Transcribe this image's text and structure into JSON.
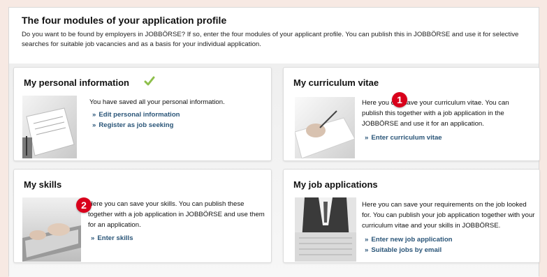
{
  "header": {
    "title": "The four modules of your application profile",
    "intro": "Do you want to be found by employers in JOBBÖRSE? If so, enter the four modules of your applicant profile. You can publish this in JOBBÖRSE and use it for selective searches for suitable job vacancies and as a basis for your individual application."
  },
  "modules": {
    "personal": {
      "title": "My personal information",
      "text": "You have saved all your personal information.",
      "links": [
        "Edit personal information",
        "Register as job seeking"
      ],
      "status_icon": "checkmark-icon"
    },
    "cv": {
      "title": "My curriculum vitae",
      "text": "Here you can save your curriculum vitae. You can publish this together with a job application in the JOBBÖRSE and use it for an application.",
      "links": [
        "Enter curriculum vitae"
      ]
    },
    "skills": {
      "title": "My skills",
      "text": "Here you can save your skills. You can publish these together with a job application in JOBBÖRSE and use them for an application.",
      "links": [
        "Enter skills"
      ]
    },
    "applications": {
      "title": "My job applications",
      "text": "Here you can save your requirements on the job looked for. You can publish your job application together with your curriculum vitae and your skills in JOBBÖRSE.",
      "links": [
        "Enter new job application",
        "Suitable jobs by email"
      ]
    }
  },
  "badges": [
    "1",
    "2"
  ],
  "colors": {
    "link": "#2a5578",
    "badge": "#d9001b",
    "check": "#8dbf4a"
  }
}
